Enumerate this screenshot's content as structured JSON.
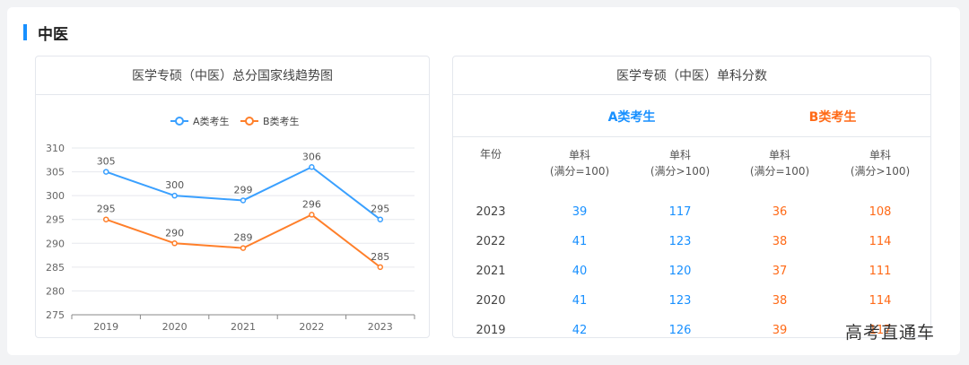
{
  "section": {
    "title": "中医"
  },
  "chart_card": {
    "title": "医学专硕（中医）总分国家线趋势图"
  },
  "table_card": {
    "title": "医学专硕（中医）单科分数"
  },
  "chart_data": {
    "type": "line",
    "categories": [
      "2019",
      "2020",
      "2021",
      "2022",
      "2023"
    ],
    "series": [
      {
        "name": "A类考生",
        "color": "#3aa0ff",
        "values": [
          305,
          300,
          299,
          306,
          295
        ]
      },
      {
        "name": "B类考生",
        "color": "#ff7f2a",
        "values": [
          295,
          290,
          289,
          296,
          285
        ]
      }
    ],
    "ylim": [
      275,
      310
    ],
    "yticks": [
      310,
      305,
      300,
      295,
      290,
      285,
      280,
      275
    ],
    "grid": true,
    "legend": "top-center",
    "title": "",
    "xlabel": "",
    "ylabel": ""
  },
  "table": {
    "groups": {
      "a": "A类考生",
      "b": "B类考生"
    },
    "headers": {
      "year": "年份",
      "a1": [
        "单科",
        "(满分=100)"
      ],
      "a2": [
        "单科",
        "(满分>100)"
      ],
      "b1": [
        "单科",
        "(满分=100)"
      ],
      "b2": [
        "单科",
        "(满分>100)"
      ]
    },
    "rows": [
      {
        "year": "2023",
        "a1": "39",
        "a2": "117",
        "b1": "36",
        "b2": "108"
      },
      {
        "year": "2022",
        "a1": "41",
        "a2": "123",
        "b1": "38",
        "b2": "114"
      },
      {
        "year": "2021",
        "a1": "40",
        "a2": "120",
        "b1": "37",
        "b2": "111"
      },
      {
        "year": "2020",
        "a1": "41",
        "a2": "123",
        "b1": "38",
        "b2": "114"
      },
      {
        "year": "2019",
        "a1": "42",
        "a2": "126",
        "b1": "39",
        "b2": "117"
      }
    ]
  },
  "watermark": "高考直通车"
}
